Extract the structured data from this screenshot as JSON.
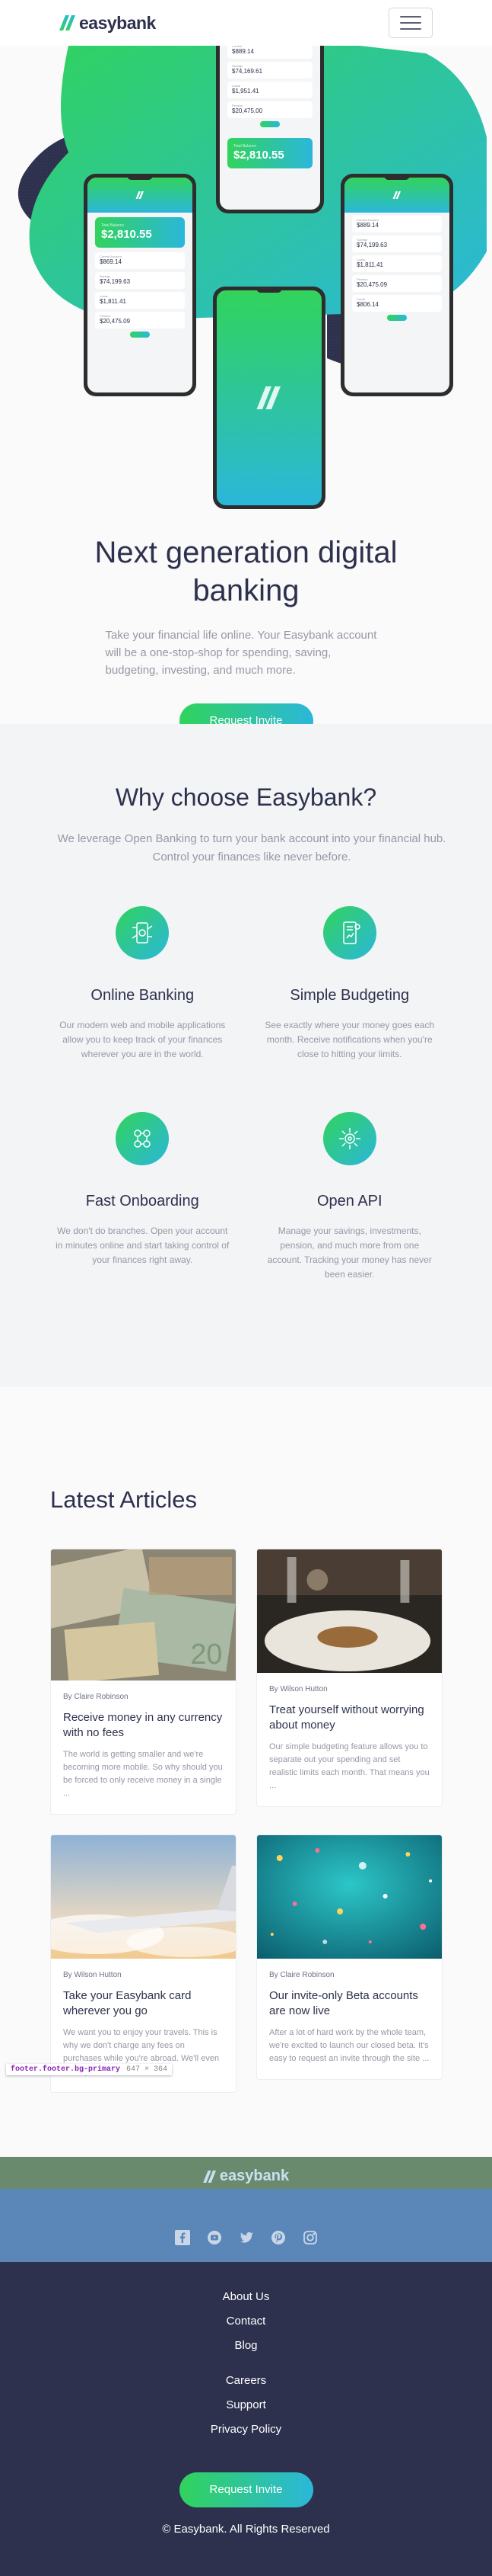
{
  "header": {
    "logo_text": "easybank",
    "menu_icon": "hamburger-icon"
  },
  "hero": {
    "title": "Next generation digital banking",
    "intro": "Take your financial life online. Your Easybank account will be a one-stop-shop for spending, saving, budgeting, investing, and much more.",
    "cta_label": "Request Invite",
    "mockup": {
      "balance": "$2,810.55",
      "accounts": [
        "$869.14",
        "$74,199.63",
        "$1,811.41",
        "$20,475.09",
        "$806.14"
      ],
      "top_list": [
        "$889.14",
        "$74,169.61",
        "$1,951.41",
        "$20,475.00"
      ]
    }
  },
  "why": {
    "title": "Why choose Easybank?",
    "subtitle": "We leverage Open Banking to turn your bank account into your financial hub. Control your finances like never before.",
    "features": [
      {
        "icon": "online-banking-icon",
        "title": "Online Banking",
        "text": "Our modern web and mobile applications allow you to keep track of your finances wherever you are in the world."
      },
      {
        "icon": "budgeting-icon",
        "title": "Simple Budgeting",
        "text": "See exactly where your money goes each month. Receive notifications when you're close to hitting your limits."
      },
      {
        "icon": "onboarding-icon",
        "title": "Fast Onboarding",
        "text": "We don't do branches. Open your account in minutes online and start taking control of your finances right away."
      },
      {
        "icon": "api-icon",
        "title": "Open API",
        "text": "Manage your savings, investments, pension, and much more from one account. Tracking your money has never been easier."
      }
    ]
  },
  "articles": {
    "title": "Latest Articles",
    "items": [
      {
        "author": "By Claire Robinson",
        "title": "Receive money in any currency with no fees",
        "excerpt": "The world is getting smaller and we're becoming more mobile. So why should you be forced to only receive money in a single ...",
        "image": "currency-photo"
      },
      {
        "author": "By Wilson Hutton",
        "title": "Treat yourself without worrying about money",
        "excerpt": "Our simple budgeting feature allows you to separate out your spending and set realistic limits each month. That means you ...",
        "image": "restaurant-photo"
      },
      {
        "author": "By Wilson Hutton",
        "title": "Take your Easybank card wherever you go",
        "excerpt": "We want you to enjoy your travels. This is why we don't charge any fees on purchases while you're abroad. We'll even show you ...",
        "image": "plane-photo"
      },
      {
        "author": "By Claire Robinson",
        "title": "Our invite-only Beta accounts are now live",
        "excerpt": "After a lot of hard work by the whole team, we're excited to launch our closed beta. It's easy to request an invite through the site ...",
        "image": "confetti-photo"
      }
    ]
  },
  "devtools_badge": {
    "selector": "footer.footer.bg-primary",
    "size": "647 × 364"
  },
  "footer": {
    "logo_text": "easybank",
    "socials": [
      "facebook-icon",
      "youtube-icon",
      "twitter-icon",
      "pinterest-icon",
      "instagram-icon"
    ],
    "links_primary": [
      "About Us",
      "Contact",
      "Blog"
    ],
    "links_secondary": [
      "Careers",
      "Support",
      "Privacy Policy"
    ],
    "cta_label": "Request Invite",
    "copyright": "© Easybank. All Rights Reserved"
  },
  "colors": {
    "dark_blue": "#2d314d",
    "lime_green": "#31d35c",
    "bright_cyan": "#2bb7da",
    "grayish_blue": "#9698a6",
    "light_gray": "#f3f4f6"
  }
}
